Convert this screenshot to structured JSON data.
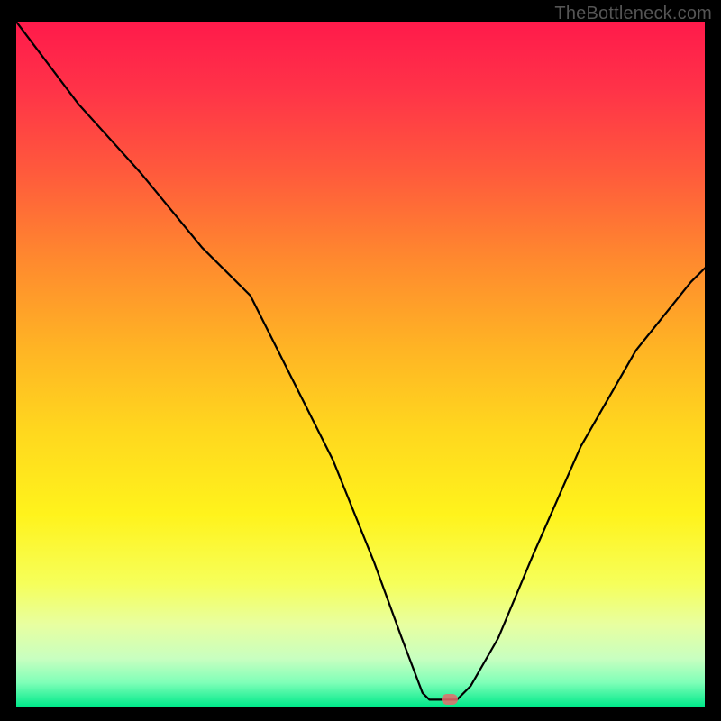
{
  "watermark": "TheBottleneck.com",
  "gradient": {
    "stops": [
      {
        "offset": 0.0,
        "color": "#ff1a4b"
      },
      {
        "offset": 0.1,
        "color": "#ff3348"
      },
      {
        "offset": 0.22,
        "color": "#ff5a3c"
      },
      {
        "offset": 0.35,
        "color": "#ff8a2e"
      },
      {
        "offset": 0.48,
        "color": "#ffb524"
      },
      {
        "offset": 0.6,
        "color": "#ffd81e"
      },
      {
        "offset": 0.72,
        "color": "#fff31c"
      },
      {
        "offset": 0.82,
        "color": "#f6ff5a"
      },
      {
        "offset": 0.88,
        "color": "#e8ffa0"
      },
      {
        "offset": 0.93,
        "color": "#c8ffc0"
      },
      {
        "offset": 0.965,
        "color": "#7fffb8"
      },
      {
        "offset": 1.0,
        "color": "#00e98a"
      }
    ]
  },
  "chart_data": {
    "type": "line",
    "title": "",
    "xlabel": "",
    "ylabel": "",
    "xlim": [
      0,
      100
    ],
    "ylim": [
      0,
      100
    ],
    "x": [
      0,
      9,
      18,
      27,
      34,
      40,
      46,
      52,
      56,
      59,
      60,
      64,
      66,
      70,
      75,
      82,
      90,
      98,
      100
    ],
    "values": [
      100,
      88,
      78,
      67,
      60,
      48,
      36,
      21,
      10,
      2,
      1,
      1,
      3,
      10,
      22,
      38,
      52,
      62,
      64
    ],
    "marker": {
      "x": 63,
      "y": 1
    }
  }
}
